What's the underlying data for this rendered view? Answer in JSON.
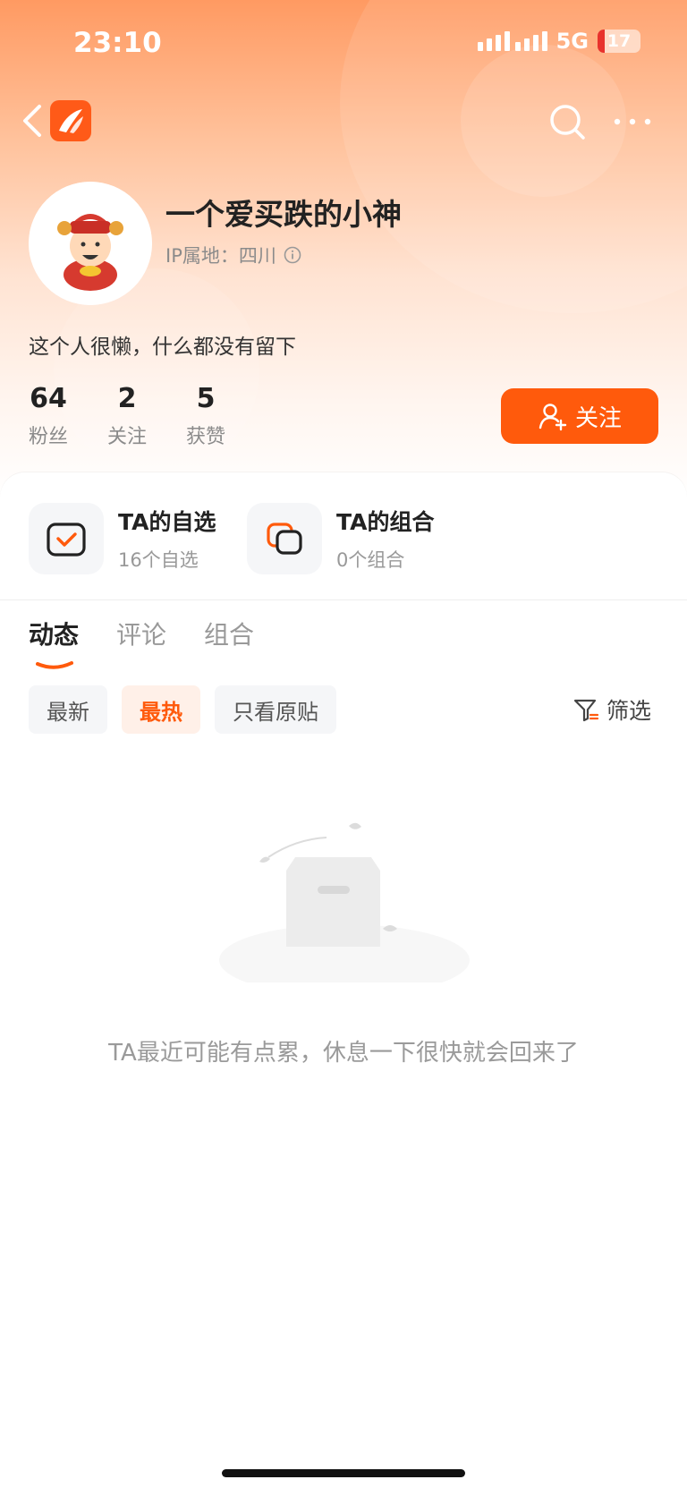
{
  "status_bar": {
    "time": "23:10",
    "network": "5G",
    "battery": "17",
    "battery_level": 0.17
  },
  "nav": {
    "back_icon": "chevron-left-icon",
    "logo_icon": "app-logo-icon",
    "search_icon": "search-icon",
    "more_icon": "more-dots-icon"
  },
  "profile": {
    "username": "一个爱买跌的小神",
    "ip": "IP属地：四川",
    "bio": "这个人很懒，什么都没有留下",
    "stats": [
      {
        "value": "64",
        "label": "粉丝"
      },
      {
        "value": "2",
        "label": "关注"
      },
      {
        "value": "5",
        "label": "获赞"
      }
    ],
    "follow_label": "关注"
  },
  "quick_links": [
    {
      "title": "TA的自选",
      "subtitle": "16个自选"
    },
    {
      "title": "TA的组合",
      "subtitle": "0个组合"
    }
  ],
  "tabs": [
    {
      "label": "动态",
      "active": true
    },
    {
      "label": "评论",
      "active": false
    },
    {
      "label": "组合",
      "active": false
    }
  ],
  "filters": [
    {
      "label": "最新",
      "active": false
    },
    {
      "label": "最热",
      "active": true
    },
    {
      "label": "只看原贴",
      "active": false
    }
  ],
  "filter_button": "筛选",
  "empty_message": "TA最近可能有点累，休息一下很快就会回来了",
  "colors": {
    "accent": "#ff5a0c",
    "accent_light": "#fff0e8"
  }
}
